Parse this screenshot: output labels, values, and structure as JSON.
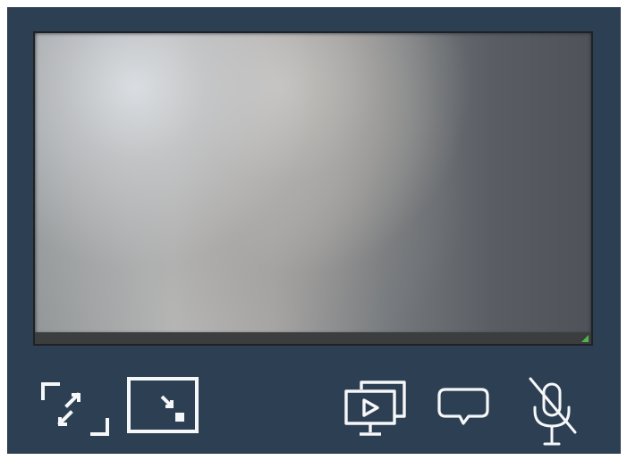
{
  "window": {
    "title": "",
    "background_color": "#2d3f52"
  },
  "video": {
    "state": "blurred-camera-preview",
    "status_text": ""
  },
  "controls": [
    {
      "name": "fullscreen-button",
      "icon": "expand-icon",
      "label": ""
    },
    {
      "name": "minimize-button",
      "icon": "minimize-to-corner-icon",
      "label": ""
    },
    {
      "name": "screen-share-button",
      "icon": "screen-share-icon",
      "label": ""
    },
    {
      "name": "chat-button",
      "icon": "chat-bubble-icon",
      "label": ""
    },
    {
      "name": "microphone-button",
      "icon": "microphone-muted-icon",
      "label": ""
    }
  ],
  "colors": {
    "panel": "#2d3f52",
    "icon": "#f5f7f9",
    "status_bar": "#3b3d3f",
    "resize_handle": "#4fb74d"
  }
}
